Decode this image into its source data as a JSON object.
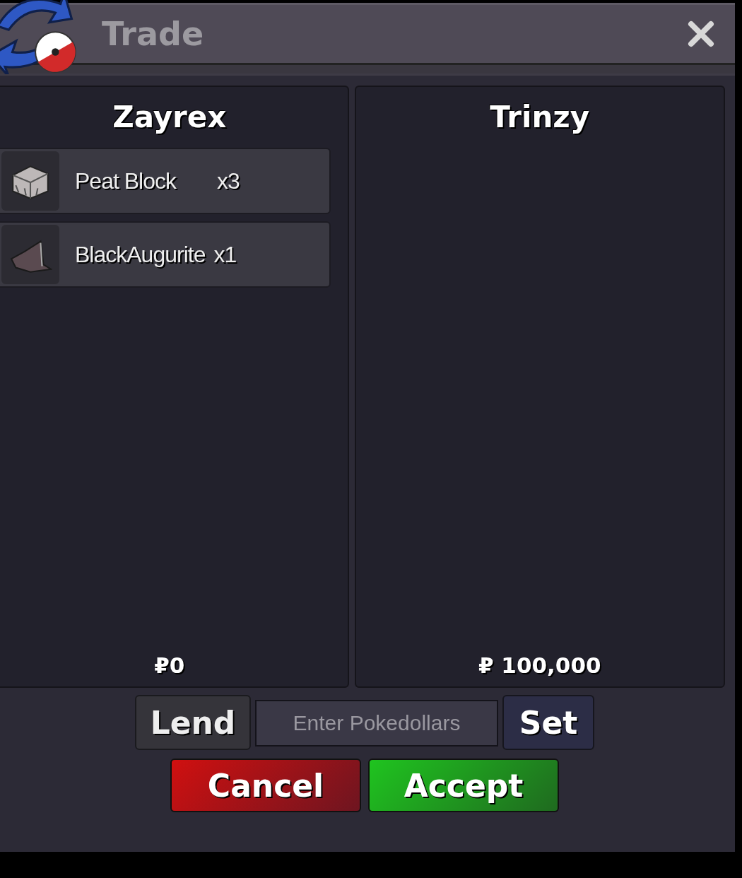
{
  "window": {
    "title": "Trade"
  },
  "panels": [
    {
      "player": "Zayrex",
      "items": [
        {
          "name": "Peat Block",
          "quantity": "x3",
          "kind": "block"
        },
        {
          "name": "BlackAugurite",
          "quantity": "x1",
          "kind": "shard"
        }
      ],
      "money": "₽0"
    },
    {
      "player": "Trinzy",
      "money": "₽ 100,000"
    }
  ],
  "lend_button": "Lend",
  "money_field": {
    "placeholder": "Enter Pokedollars"
  },
  "set_button": "Set",
  "buttons": [
    {
      "label": "Cancel",
      "kind": "cancel"
    },
    {
      "label": "Accept",
      "kind": "accept"
    }
  ]
}
